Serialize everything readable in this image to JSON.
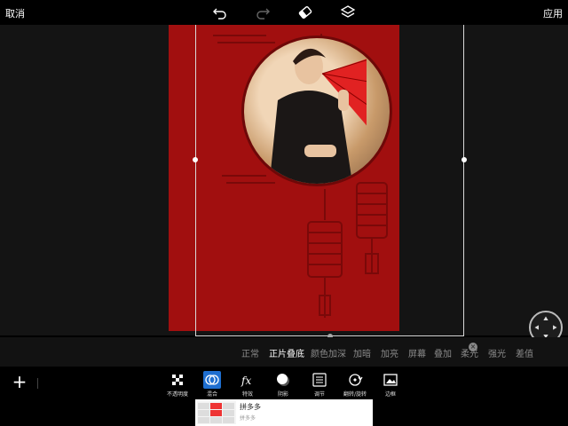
{
  "topbar": {
    "cancel_label": "取消",
    "apply_label": "应用"
  },
  "blend_modes": {
    "items": [
      "正常",
      "正片叠底",
      "颜色加深",
      "加暗",
      "加亮",
      "屏幕",
      "叠加",
      "柔光",
      "强光",
      "差值"
    ],
    "selected": "正片叠底"
  },
  "toolbar": {
    "add_label": "+",
    "tools": [
      {
        "label": "不透明度",
        "icon": "opacity-icon"
      },
      {
        "label": "混合",
        "icon": "blend-icon"
      },
      {
        "label": "特效",
        "icon": "fx-icon"
      },
      {
        "label": "阴影",
        "icon": "shadow-icon"
      },
      {
        "label": "调节",
        "icon": "adjust-icon"
      },
      {
        "label": "翻转/旋转",
        "icon": "flip-rotate-icon"
      },
      {
        "label": "边框",
        "icon": "border-icon"
      }
    ]
  },
  "ad": {
    "title": "拼多多",
    "subtitle": "拼多多"
  },
  "colors": {
    "poster_red": "#a10f0f",
    "fan_red": "#e12222",
    "accent_blue": "#1f6fd0"
  }
}
